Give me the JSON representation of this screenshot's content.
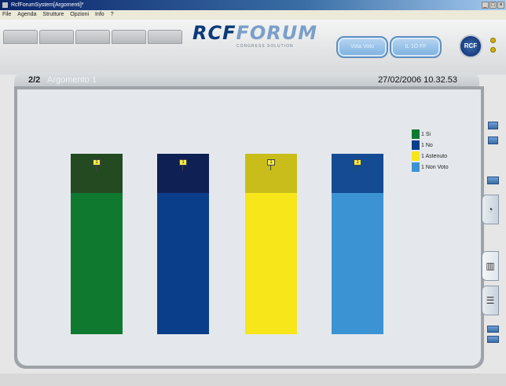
{
  "window": {
    "title": "RcfForumSystem[Argomenti]*"
  },
  "menu": [
    "File",
    "Agenda",
    "Strutture",
    "Opzioni",
    "Info",
    "?"
  ],
  "logo": {
    "text1": "RCF",
    "text2": "FORUM",
    "subtitle": "CONGRESS SOLUTION"
  },
  "header": {
    "pill1": "Vota Voto",
    "pill2": "IL 1O FF",
    "rcf_button": "RCF"
  },
  "panel": {
    "count": "2/2",
    "subject": "Argomento 1",
    "datetime": "27/02/2006 10.32.53"
  },
  "chart_data": {
    "type": "bar",
    "categories": [
      "1 Si",
      "1 No",
      "1 Astenuto",
      "1 Non Voto"
    ],
    "values": [
      1,
      1,
      1,
      1
    ],
    "data_labels": [
      "1",
      "1",
      "1",
      "1"
    ],
    "colors": [
      "#0f7a2f",
      "#0b3e8a",
      "#f7e61a",
      "#3c93d4"
    ],
    "top_colors": [
      "#244a22",
      "#0f2054",
      "#c9bd1b",
      "#144b93"
    ],
    "legend": [
      "1 Si",
      "1 No",
      "1 Astenuto",
      "1 Non Voto"
    ],
    "legend_position": "top-right",
    "grid": false
  }
}
